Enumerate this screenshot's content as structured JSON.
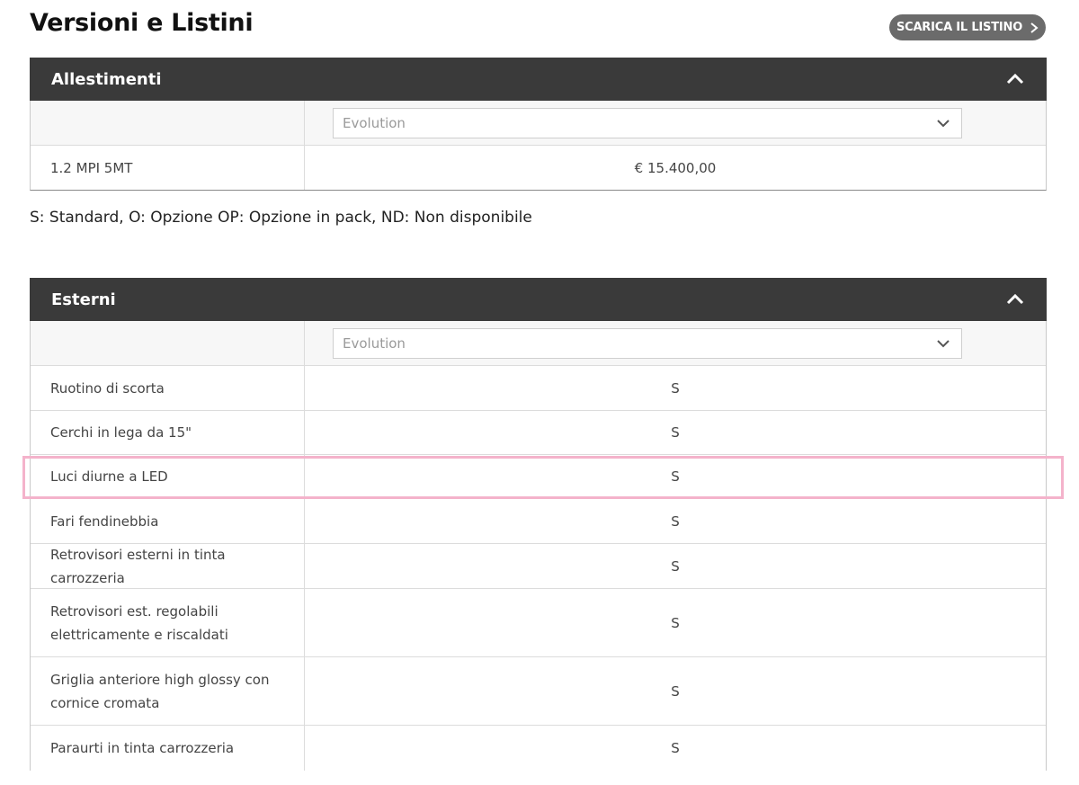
{
  "page": {
    "title": "Versioni e Listini",
    "download_label": "SCARICA IL LISTINO",
    "legend": "S: Standard, O: Opzione OP: Opzione in pack, ND: Non disponibile"
  },
  "allestimenti": {
    "header": "Allestimenti",
    "selected_version": "Evolution",
    "rows": [
      {
        "name": "1.2 MPI 5MT",
        "value": "€ 15.400,00"
      }
    ]
  },
  "esterni": {
    "header": "Esterni",
    "selected_version": "Evolution",
    "rows": [
      {
        "name": "Ruotino di scorta",
        "value": "S"
      },
      {
        "name": "Cerchi in lega da 15\"",
        "value": "S"
      },
      {
        "name": "Luci diurne a LED",
        "value": "S"
      },
      {
        "name": "Fari fendinebbia",
        "value": "S"
      },
      {
        "name": "Retrovisori esterni in tinta carrozzeria",
        "value": "S"
      },
      {
        "name": "Retrovisori est. regolabili elettricamente e riscaldati",
        "value": "S"
      },
      {
        "name": "Griglia anteriore high glossy con cornice cromata",
        "value": "S"
      },
      {
        "name": "Paraurti in tinta carrozzeria",
        "value": "S"
      }
    ]
  },
  "colors": {
    "header_bg": "#3a3a3a",
    "button_bg": "#6b6b6b",
    "highlight": "#f4b3cb"
  },
  "icons": {
    "download_chevron": "chevron-right-icon",
    "collapse": "chevron-up-icon",
    "dropdown": "chevron-down-icon"
  }
}
